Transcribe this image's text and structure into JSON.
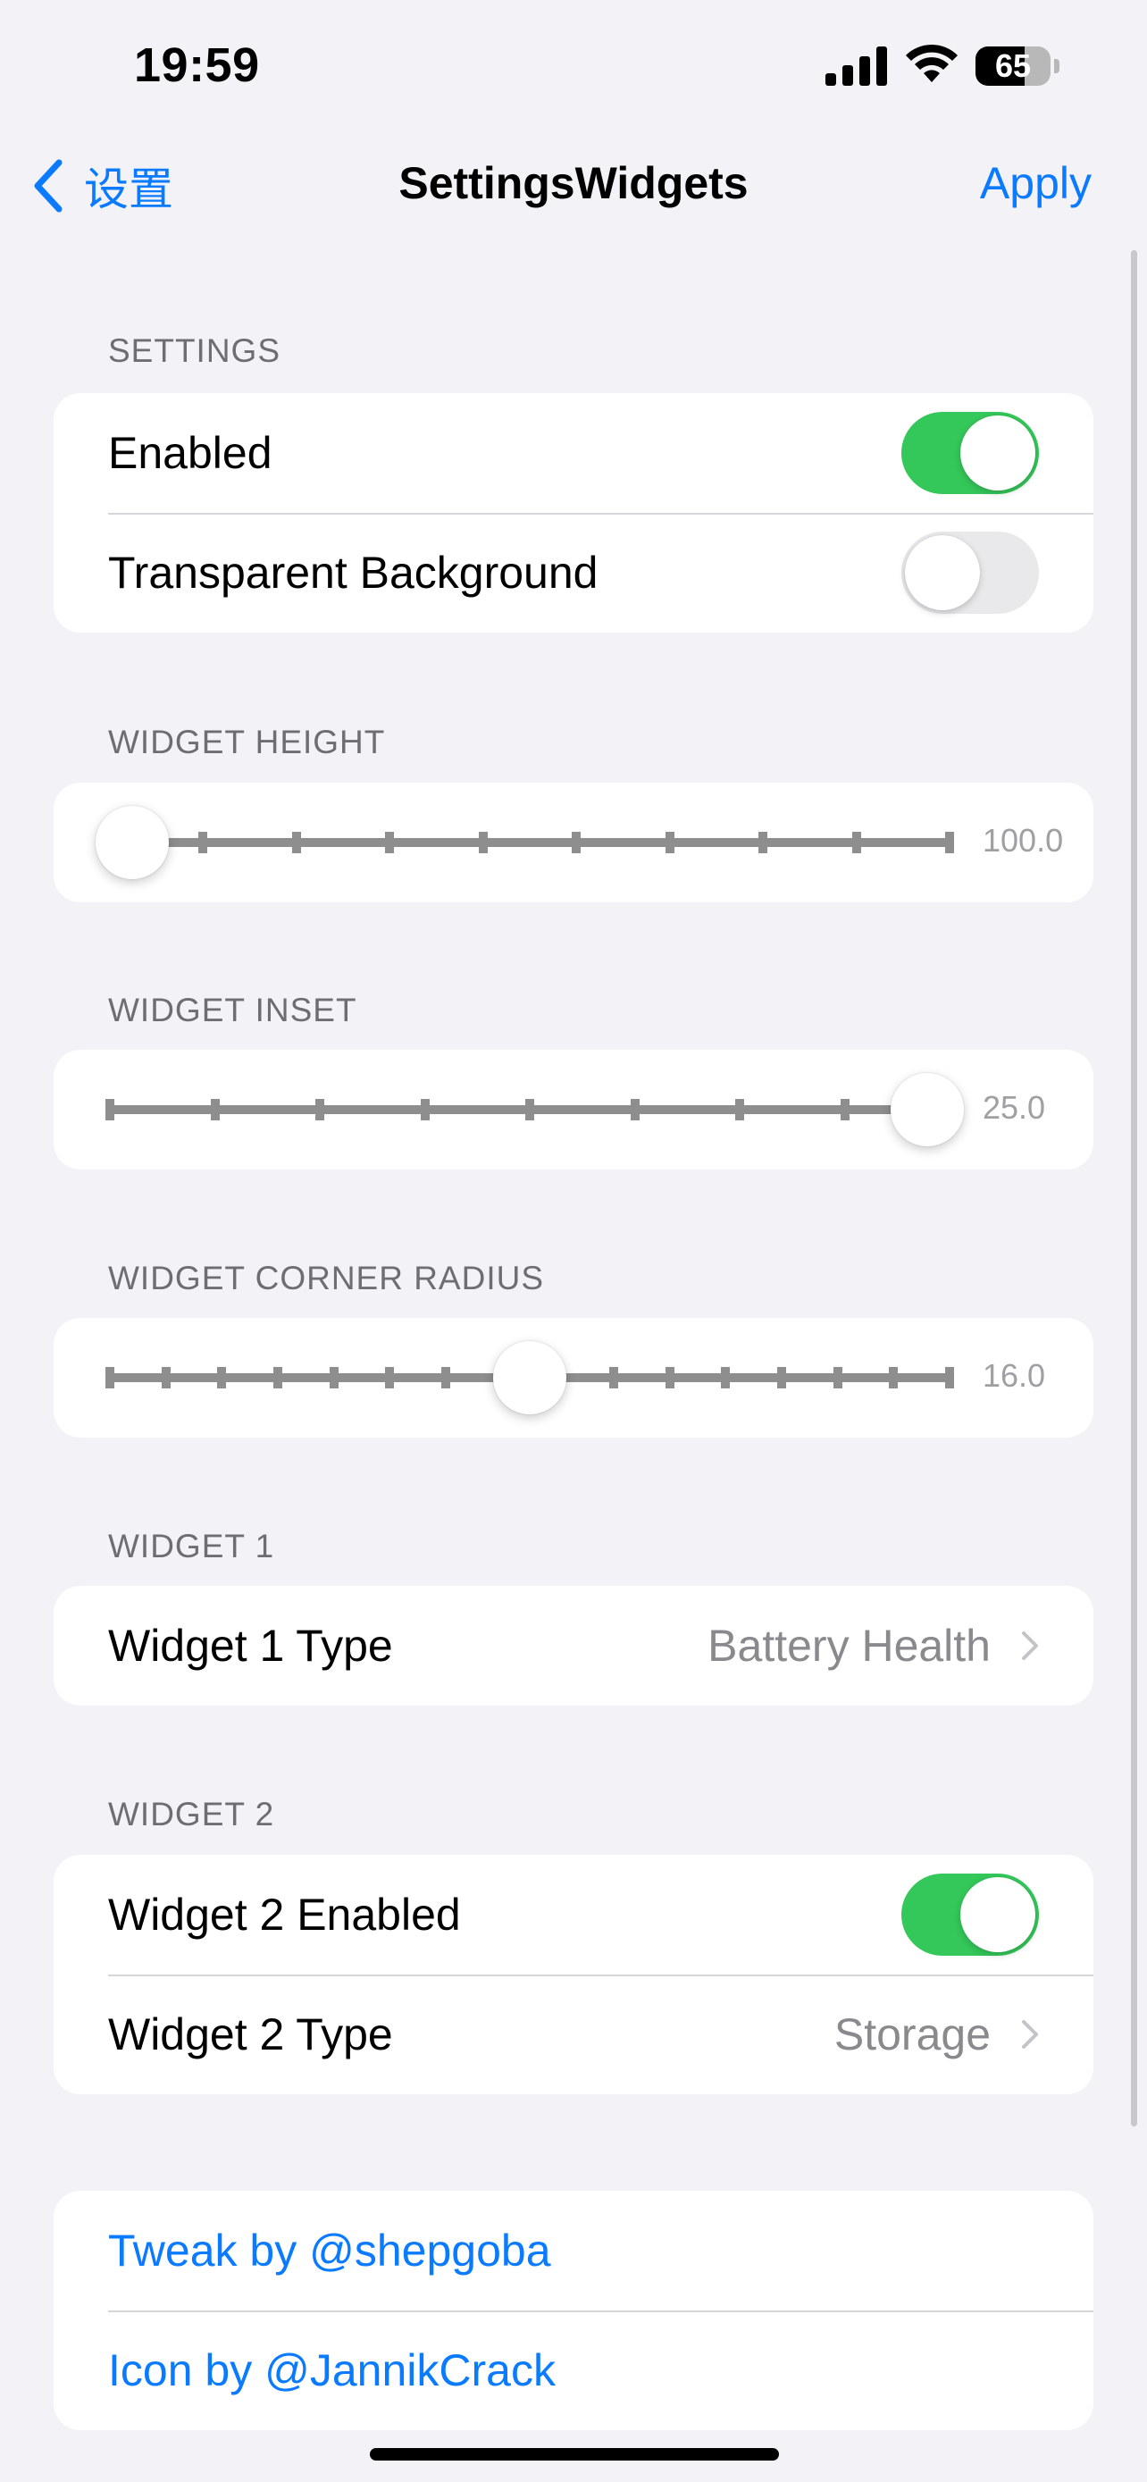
{
  "status_bar": {
    "time": "19:59",
    "battery_percent": 65,
    "battery_label": "65"
  },
  "nav": {
    "back_label": "设置",
    "title": "SettingsWidgets",
    "apply_label": "Apply"
  },
  "settings": {
    "header": "SETTINGS",
    "enabled_label": "Enabled",
    "enabled": true,
    "transparent_label": "Transparent Background",
    "transparent": false
  },
  "widget_height": {
    "header": "WIDGET HEIGHT",
    "value_text": "100.0",
    "position": 0.0,
    "ticks": 10
  },
  "widget_inset": {
    "header": "WIDGET INSET",
    "value_text": "25.0",
    "position": 1.0,
    "ticks": 9
  },
  "widget_corner_radius": {
    "header": "WIDGET CORNER RADIUS",
    "value_text": "16.0",
    "position": 0.5,
    "ticks": 16
  },
  "widget1": {
    "header": "WIDGET 1",
    "type_label": "Widget 1 Type",
    "type_value": "Battery Health"
  },
  "widget2": {
    "header": "WIDGET 2",
    "enabled_label": "Widget 2 Enabled",
    "enabled": true,
    "type_label": "Widget 2 Type",
    "type_value": "Storage"
  },
  "credits": {
    "tweak": "Tweak by @shepgoba",
    "icon": "Icon by @JannikCrack"
  },
  "colors": {
    "accent": "#0A7AFF",
    "toggle_on": "#34C759",
    "background": "#F2F2F7"
  }
}
